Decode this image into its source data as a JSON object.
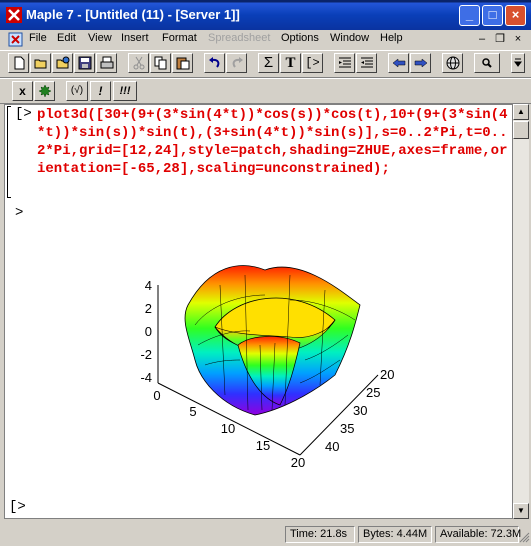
{
  "window": {
    "title": "Maple 7  - [Untitled (11) - [Server 1]]",
    "minimize_label": "_",
    "maximize_label": "□",
    "close_label": "×"
  },
  "menu": {
    "items": [
      {
        "label": "File",
        "enabled": true
      },
      {
        "label": "Edit",
        "enabled": true
      },
      {
        "label": "View",
        "enabled": true
      },
      {
        "label": "Insert",
        "enabled": true
      },
      {
        "label": "Format",
        "enabled": true
      },
      {
        "label": "Spreadsheet",
        "enabled": false
      },
      {
        "label": "Options",
        "enabled": true
      },
      {
        "label": "Window",
        "enabled": true
      },
      {
        "label": "Help",
        "enabled": true
      }
    ],
    "doc_minimize": "–",
    "doc_restore": "❐",
    "doc_close": "×"
  },
  "toolbar": {
    "sum_label": "Σ",
    "text_label": "T",
    "exec_label": "[>",
    "math_x_label": "x",
    "expr_label": "(√)",
    "exec_one_label": "!",
    "exec_all_label": "!!!"
  },
  "worksheet": {
    "prompt1": "[>",
    "command": "plot3d([30+(9+(3*sin(4*t))*cos(s))*cos(t),10+(9+(3*sin(4*t))*sin(s))*sin(t),(3+sin(4*t))*sin(s)],s=0..2*Pi,t=0..2*Pi,grid=[12,24],style=patch,shading=ZHUE,axes=frame,orientation=[-65,28],scaling=unconstrained);",
    "prompt2": ">",
    "prompt3": "[>"
  },
  "plot": {
    "z_ticks": [
      "4",
      "2",
      "0",
      "-2",
      "-4"
    ],
    "x_ticks": [
      "0",
      "5",
      "10",
      "15",
      "20"
    ],
    "y_ticks": [
      "20",
      "25",
      "30",
      "35",
      "40"
    ]
  },
  "status": {
    "time": "Time: 21.8s",
    "bytes": "Bytes: 4.44M",
    "available": "Available: 72.3M"
  }
}
